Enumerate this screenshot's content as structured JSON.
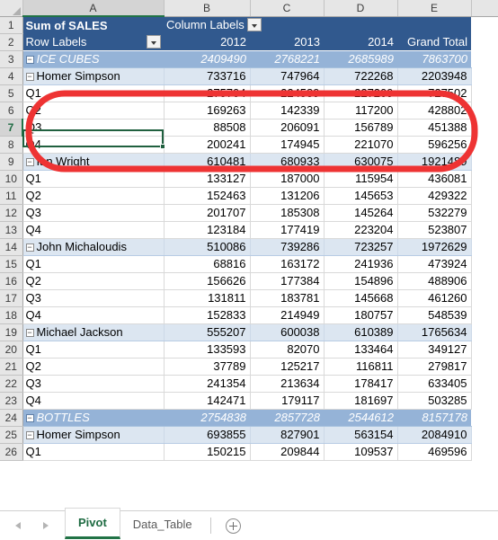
{
  "workbook": {
    "sheet_tabs": [
      {
        "label": "Pivot",
        "active": true
      },
      {
        "label": "Data_Table",
        "active": false
      }
    ],
    "add_sheet_label": "+",
    "nav_prev_label": "◀",
    "nav_next_label": "▶"
  },
  "grid": {
    "column_headers": [
      "A",
      "B",
      "C",
      "D",
      "E"
    ],
    "active_column": "A",
    "active_row": "7",
    "selected_cell": "A7",
    "row_numbers": [
      "1",
      "2",
      "3",
      "4",
      "5",
      "6",
      "7",
      "8",
      "9",
      "10",
      "11",
      "12",
      "13",
      "14",
      "15",
      "16",
      "17",
      "18",
      "19",
      "20",
      "21",
      "22",
      "23",
      "24",
      "25",
      "26"
    ]
  },
  "pivot": {
    "value_field_label": "Sum of SALES",
    "column_labels_label": "Column Labels",
    "row_labels_label": "Row Labels",
    "collapse_glyph": "−",
    "headers": {
      "row_label_col": "Row Labels",
      "years": [
        "2012",
        "2013",
        "2014"
      ],
      "grand_total": "Grand Total"
    },
    "rows": [
      {
        "row": "3",
        "level": 1,
        "label": "ICE CUBES",
        "values": [
          "2409490",
          "2768221",
          "2685989",
          "7863700"
        ]
      },
      {
        "row": "4",
        "level": 2,
        "label": "Homer Simpson",
        "values": [
          "733716",
          "747964",
          "722268",
          "2203948"
        ]
      },
      {
        "row": "5",
        "level": 3,
        "label": "Q1",
        "values": [
          "275704",
          "224589",
          "227209",
          "727502"
        ]
      },
      {
        "row": "6",
        "level": 3,
        "label": "Q2",
        "values": [
          "169263",
          "142339",
          "117200",
          "428802"
        ]
      },
      {
        "row": "7",
        "level": 3,
        "label": "Q3",
        "values": [
          "88508",
          "206091",
          "156789",
          "451388"
        ]
      },
      {
        "row": "8",
        "level": 3,
        "label": "Q4",
        "values": [
          "200241",
          "174945",
          "221070",
          "596256"
        ]
      },
      {
        "row": "9",
        "level": 2,
        "label": "Ian Wright",
        "values": [
          "610481",
          "680933",
          "630075",
          "1921489"
        ]
      },
      {
        "row": "10",
        "level": 3,
        "label": "Q1",
        "values": [
          "133127",
          "187000",
          "115954",
          "436081"
        ]
      },
      {
        "row": "11",
        "level": 3,
        "label": "Q2",
        "values": [
          "152463",
          "131206",
          "145653",
          "429322"
        ]
      },
      {
        "row": "12",
        "level": 3,
        "label": "Q3",
        "values": [
          "201707",
          "185308",
          "145264",
          "532279"
        ]
      },
      {
        "row": "13",
        "level": 3,
        "label": "Q4",
        "values": [
          "123184",
          "177419",
          "223204",
          "523807"
        ]
      },
      {
        "row": "14",
        "level": 2,
        "label": "John Michaloudis",
        "values": [
          "510086",
          "739286",
          "723257",
          "1972629"
        ]
      },
      {
        "row": "15",
        "level": 3,
        "label": "Q1",
        "values": [
          "68816",
          "163172",
          "241936",
          "473924"
        ]
      },
      {
        "row": "16",
        "level": 3,
        "label": "Q2",
        "values": [
          "156626",
          "177384",
          "154896",
          "488906"
        ]
      },
      {
        "row": "17",
        "level": 3,
        "label": "Q3",
        "values": [
          "131811",
          "183781",
          "145668",
          "461260"
        ]
      },
      {
        "row": "18",
        "level": 3,
        "label": "Q4",
        "values": [
          "152833",
          "214949",
          "180757",
          "548539"
        ]
      },
      {
        "row": "19",
        "level": 2,
        "label": "Michael Jackson",
        "values": [
          "555207",
          "600038",
          "610389",
          "1765634"
        ]
      },
      {
        "row": "20",
        "level": 3,
        "label": "Q1",
        "values": [
          "133593",
          "82070",
          "133464",
          "349127"
        ]
      },
      {
        "row": "21",
        "level": 3,
        "label": "Q2",
        "values": [
          "37789",
          "125217",
          "116811",
          "279817"
        ]
      },
      {
        "row": "22",
        "level": 3,
        "label": "Q3",
        "values": [
          "241354",
          "213634",
          "178417",
          "633405"
        ]
      },
      {
        "row": "23",
        "level": 3,
        "label": "Q4",
        "values": [
          "142471",
          "179117",
          "181697",
          "503285"
        ]
      },
      {
        "row": "24",
        "level": 1,
        "label": "BOTTLES",
        "values": [
          "2754838",
          "2857728",
          "2544612",
          "8157178"
        ]
      },
      {
        "row": "25",
        "level": 2,
        "label": "Homer Simpson",
        "values": [
          "693855",
          "827901",
          "563154",
          "2084910"
        ]
      },
      {
        "row": "26",
        "level": 3,
        "label": "Q1",
        "values": [
          "150215",
          "209844",
          "109537",
          "469596"
        ]
      }
    ]
  },
  "annotation": {
    "shape": "rounded-rectangle-highlight",
    "color": "#ee3333",
    "covers_rows": [
      "5",
      "6",
      "7",
      "8"
    ]
  },
  "colors": {
    "pivot_header_bg": "#31598e",
    "level1_bg": "#95b3d7",
    "level2_bg": "#dce6f1",
    "selection_border": "#20603f",
    "tab_active": "#217346",
    "annotation_red": "#ee3333"
  }
}
